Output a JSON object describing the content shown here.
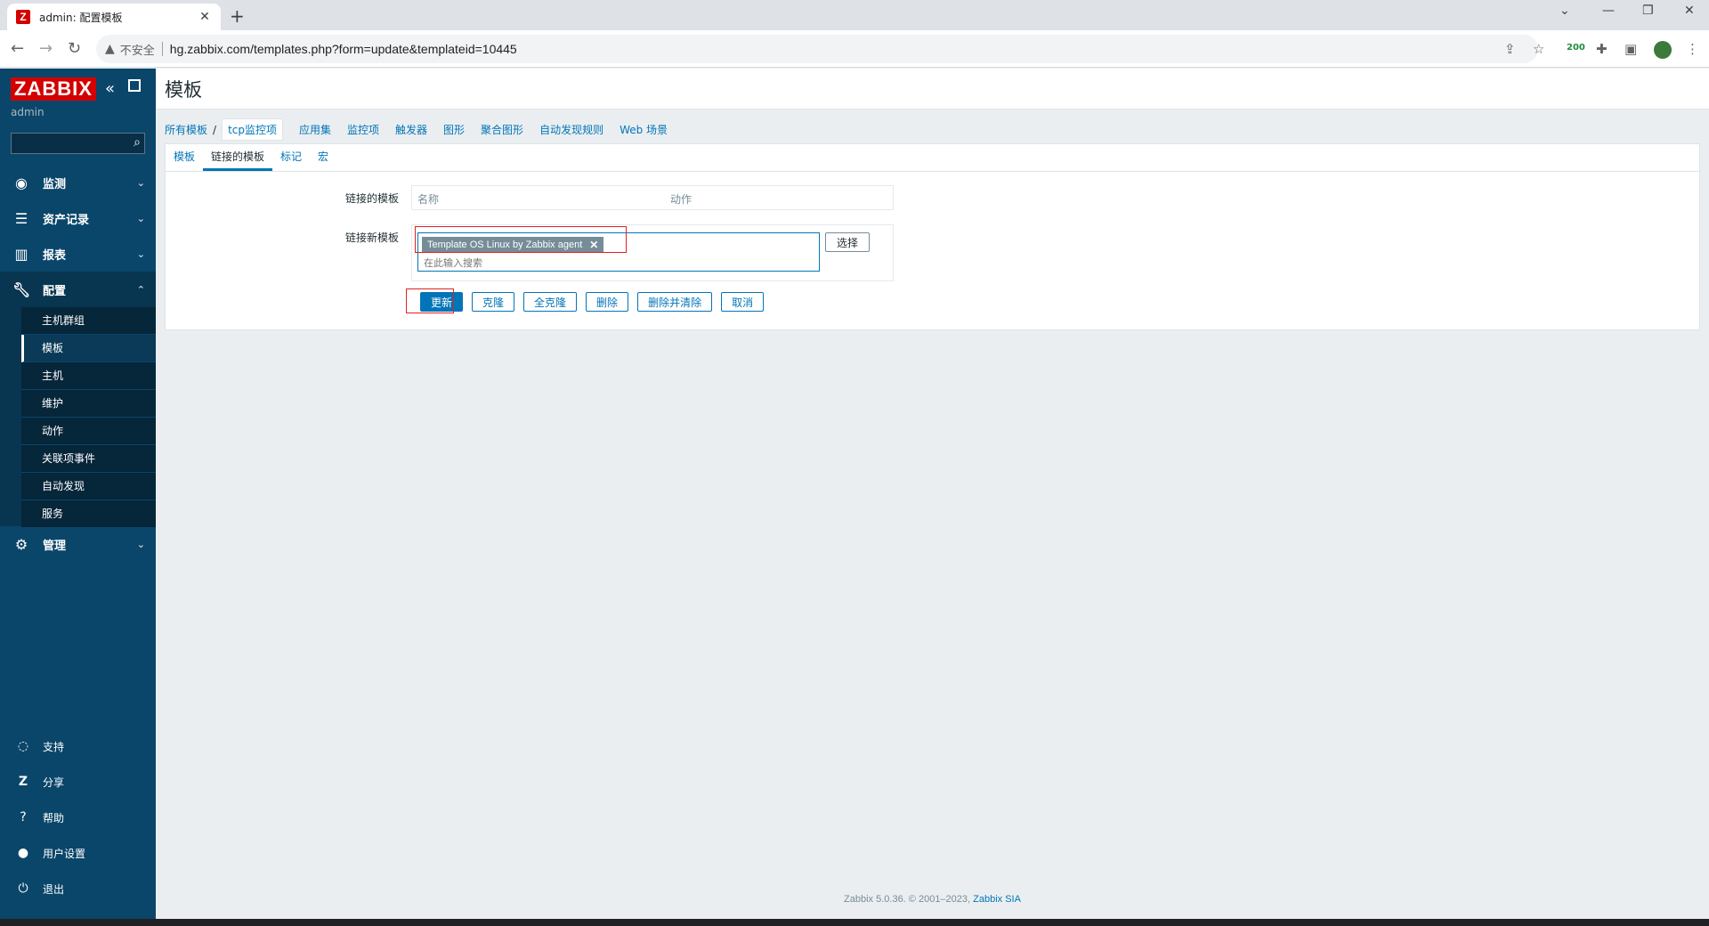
{
  "browser": {
    "tab_title": "admin: 配置模板",
    "tab_favicon": "Z",
    "insecure_label": "不安全",
    "url": "hg.zabbix.com/templates.php?form=update&templateid=10445",
    "extension_badge": "200"
  },
  "sidebar": {
    "logo": "ZABBIX",
    "user": "admin",
    "search_placeholder": "",
    "menu": [
      {
        "label": "监测",
        "icon": "eye-icon"
      },
      {
        "label": "资产记录",
        "icon": "list-icon"
      },
      {
        "label": "报表",
        "icon": "bar-chart-icon"
      },
      {
        "label": "配置",
        "icon": "wrench-icon"
      },
      {
        "label": "管理",
        "icon": "gear-icon"
      }
    ],
    "config_submenu": [
      "主机群组",
      "模板",
      "主机",
      "维护",
      "动作",
      "关联项事件",
      "自动发现",
      "服务"
    ],
    "bottom": [
      {
        "label": "支持",
        "icon": "headset-icon"
      },
      {
        "label": "分享",
        "icon": "share-z-icon"
      },
      {
        "label": "帮助",
        "icon": "question-icon"
      },
      {
        "label": "用户设置",
        "icon": "user-icon"
      },
      {
        "label": "退出",
        "icon": "power-icon"
      }
    ]
  },
  "page": {
    "title": "模板",
    "breadcrumbs": [
      "所有模板",
      "tcp监控项",
      "应用集",
      "监控项",
      "触发器",
      "图形",
      "聚合图形",
      "自动发现规则",
      "Web 场景"
    ],
    "breadcrumb_sep": "/",
    "tabs": [
      "模板",
      "链接的模板",
      "标记",
      "宏"
    ],
    "linked_label": "链接的模板",
    "linked_columns": [
      "名称",
      "动作"
    ],
    "new_label": "链接新模板",
    "chip_label": "Template OS Linux by Zabbix agent",
    "chip_remove": "✕",
    "ms_placeholder": "在此输入搜索",
    "select_label": "选择",
    "buttons": [
      "更新",
      "克隆",
      "全克隆",
      "删除",
      "删除并清除",
      "取消"
    ]
  },
  "footer": {
    "text": "Zabbix 5.0.36. © 2001–2023,",
    "link": "Zabbix SIA"
  }
}
